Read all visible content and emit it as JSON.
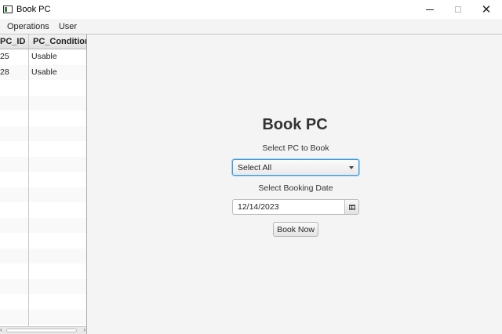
{
  "window": {
    "title": "Book PC",
    "controls": {
      "minimize": "minimize-icon",
      "maximize": "maximize-icon",
      "close": "close-icon",
      "close_glyph": "✕"
    }
  },
  "menu": {
    "items": [
      "Operations",
      "User"
    ]
  },
  "table": {
    "columns": [
      "PC_ID",
      "PC_Condition"
    ],
    "rows": [
      [
        "25",
        "Usable"
      ],
      [
        "28",
        "Usable"
      ]
    ]
  },
  "booking": {
    "title": "Book PC",
    "select_pc_label": "Select PC to Book",
    "select_pc_value": "Select All",
    "select_date_label": "Select Booking Date",
    "date_value": "12/14/2023",
    "book_button": "Book Now"
  },
  "colors": {
    "focus_border": "#3f9bd6",
    "background": "#f4f4f4"
  }
}
